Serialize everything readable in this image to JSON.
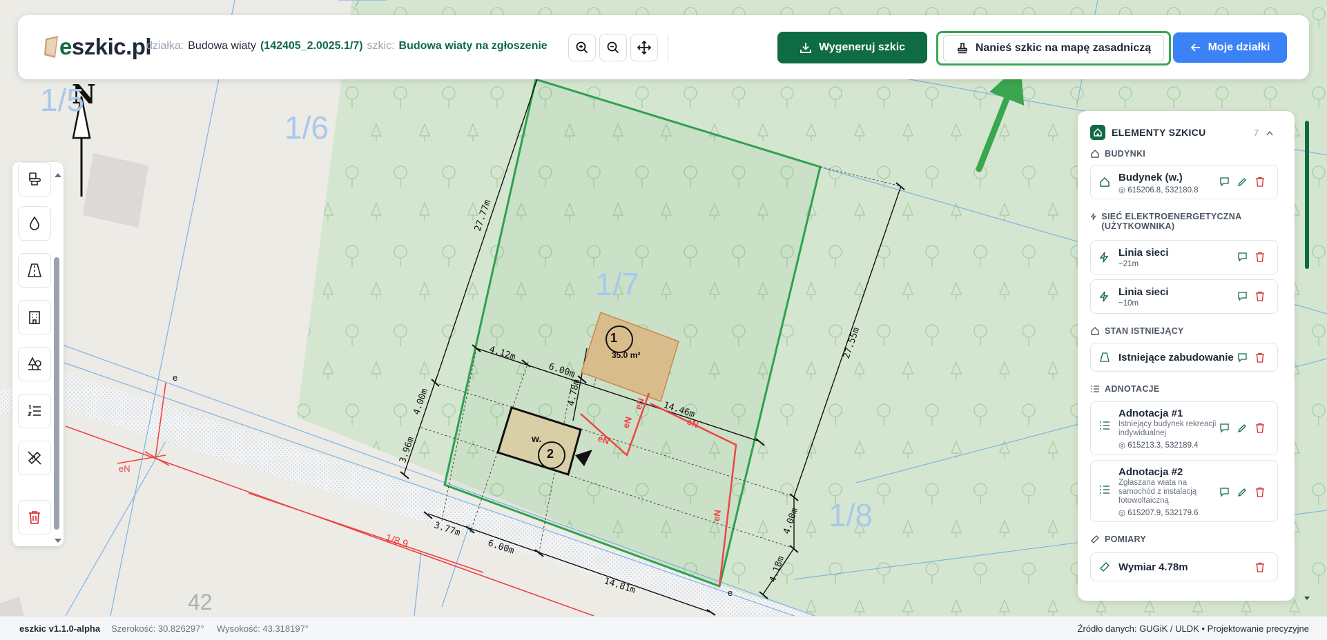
{
  "header": {
    "logo_text_e": "e",
    "logo_text_rest": "szkic.pl",
    "dzialka_label": "działka:",
    "dzialka_name": "Budowa wiaty",
    "dzialka_id": "(142405_2.0025.1/7)",
    "szkic_label": "szkic:",
    "szkic_name": "Budowa wiaty na zgłoszenie",
    "generate_label": "Wygeneruj szkic",
    "apply_label": "Nanieś szkic na mapę zasadniczą",
    "my_plots_label": "Moje działki"
  },
  "map": {
    "north": "N",
    "parcels": [
      "1/5",
      "1/6",
      "1/7",
      "1/8",
      "42"
    ],
    "road_label": "1/8.9",
    "building1": {
      "num": "1",
      "area": "35.0 m²"
    },
    "building2": {
      "num": "2",
      "label": "w."
    },
    "dims": {
      "d1": "27.77m",
      "d2": "27.55m",
      "d3": "4.12m",
      "d4": "6.00m",
      "d5": "4.78m",
      "d6": "14.46m",
      "d7": "4.00m",
      "d8": "3.96m",
      "d9": "3.77m",
      "d10": "6.00m",
      "d11": "14.81m",
      "d12": "4.00m",
      "d13": "4.18m"
    },
    "en": "eN",
    "e": "e"
  },
  "panel": {
    "title": "ELEMENTY SZKICU",
    "count": "7",
    "sections": {
      "budynki": "BUDYNKI",
      "siec": "SIEĆ ELEKTROENERGETYCZNA (UŻYTKOWNIKA)",
      "stan": "STAN ISTNIEJĄCY",
      "adnotacje": "ADNOTACJE",
      "pomiary": "POMIARY"
    },
    "items": {
      "budynek": {
        "title": "Budynek (w.)",
        "coord": "615206.8, 532180.8"
      },
      "linia1": {
        "title": "Linia sieci",
        "sub": "~21m"
      },
      "linia2": {
        "title": "Linia sieci",
        "sub": "~10m"
      },
      "istniejace": {
        "title": "Istniejące zabudowanie"
      },
      "adn1": {
        "title": "Adnotacja #1",
        "sub": "Istniejący budynek rekreacji indywidualnej",
        "coord": "615213.3, 532189.4"
      },
      "adn2": {
        "title": "Adnotacja #2",
        "sub": "Zgłaszana wiata na samochód z instalacją fotowoltaiczną",
        "coord": "615207.9, 532179.6"
      },
      "wymiar": {
        "title": "Wymiar 4.78m"
      }
    }
  },
  "status": {
    "version": "eszkic v1.1.0-alpha",
    "width": "Szerokość: 30.826297°",
    "height": "Wysokość: 43.318197°",
    "source": "Źródło danych: GUGiK / ULDK • Projektowanie precyzyjne"
  },
  "colors": {
    "brand_green": "#0f6b43",
    "accent_blue": "#3b82f6",
    "highlight_green": "#3aa64f",
    "danger_red": "#dc2626"
  }
}
